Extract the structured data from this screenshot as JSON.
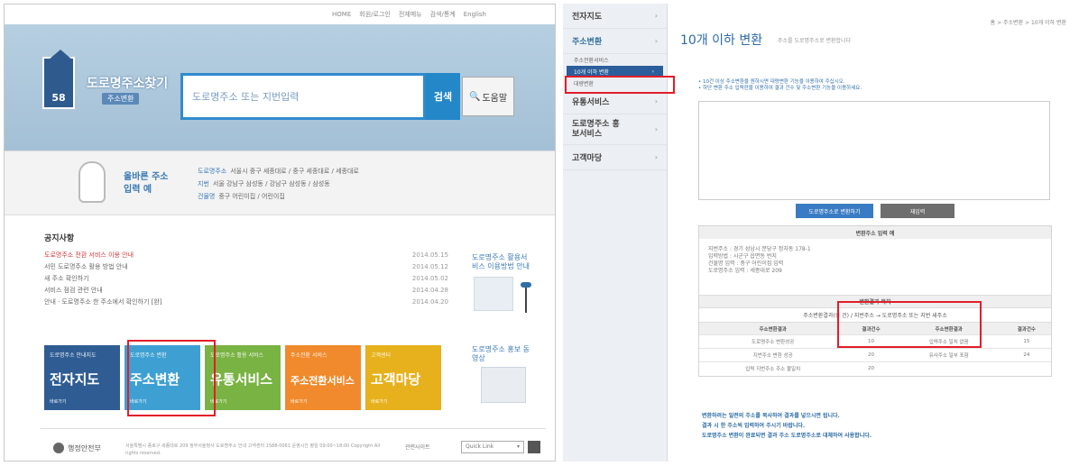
{
  "left": {
    "topbar": [
      "HOME",
      "회원/로그인",
      "전체메뉴",
      "검색/통계",
      "English"
    ],
    "logo": {
      "title": "도로명주소찾기",
      "subtitle": "주소변환",
      "badge": "58"
    },
    "search": {
      "placeholder": "도로명주소 또는 지번입력",
      "button": "검색",
      "help": "도움말"
    },
    "info": {
      "title": "올바른 주소 입력 예",
      "lines": [
        {
          "k": "도로명주소",
          "v": "서울시 중구 세종대로 / 중구 세종대로 / 세종대로"
        },
        {
          "k": "지번",
          "v": "서울 강남구 삼성동 / 강남구 삼성동 / 삼성동"
        },
        {
          "k": "건물명",
          "v": "중구 어린이집 / 어린이집"
        }
      ]
    },
    "notices": {
      "title": "공지사항",
      "items": [
        {
          "text": "도로명주소 전환 서비스 이용 안내",
          "date": "2014.05.15",
          "hot": true
        },
        {
          "text": "서민 도로명주소 활용 방법 안내",
          "date": "2014.05.12",
          "hot": false
        },
        {
          "text": "새 주소 확인하기",
          "date": "2014.05.02",
          "hot": false
        },
        {
          "text": "서비스 점검 관련 안내",
          "date": "2014.04.28",
          "hot": false
        },
        {
          "text": "안내 · 도로명주소 한 주소에서 확인하기 [완]",
          "date": "2014.04.20",
          "hot": false
        }
      ]
    },
    "promo": {
      "text": "도로명주소 활용서비스 이용방법 안내"
    },
    "tiles": [
      {
        "small": "도로명주소 안내지도",
        "big": "전자지도",
        "mini": "바로가기"
      },
      {
        "small": "도로명주소 변환",
        "big": "주소변환",
        "mini": "바로가기"
      },
      {
        "small": "도로명주소 활용 서비스",
        "big": "유통서비스",
        "mini": "바로가기"
      },
      {
        "small": "주소전환 서비스",
        "big": "주소전환서비스",
        "mini": "바로가기"
      },
      {
        "small": "고객센터",
        "big": "고객마당",
        "mini": "바로가기"
      }
    ],
    "promo2": {
      "text": "도로명주소 홍보 동영상"
    },
    "footer": {
      "org": "행정안전부",
      "text": "서울특별시 종로구 세종대로 209 정부서울청사 도로명주소 안내 고객센터 1588-0061 운영시간 평일 09:00~18:00 Copyright All rights reserved.",
      "right": "관련사이트",
      "select": "Quick Link"
    }
  },
  "right": {
    "sidebar": {
      "items": [
        {
          "label": "전자지도",
          "active": false
        },
        {
          "label": "주소변환",
          "active": true
        }
      ],
      "subs": [
        {
          "label": "주소전환서비스",
          "selected": false
        },
        {
          "label": "10개 이하 변환",
          "selected": true
        },
        {
          "label": "대량변환",
          "selected": false
        }
      ],
      "items2": [
        {
          "label": "유통서비스"
        },
        {
          "label": "도로명주소 홍보서비스"
        },
        {
          "label": "고객마당"
        }
      ]
    },
    "crumb": "홈 > 주소변환 > 10개 이하 변환",
    "title": "10개 이하 변환",
    "subtitle": "주소를 도로명주소로 변환합니다",
    "notes": [
      "• 10건 이상 주소변환을 원하시면 대량변환 기능을 이용하여 주십시오.",
      "• 하단 변환 주소 입력란을 이용하여 결과 건수 및 주소변환 기능을 이용하세요."
    ],
    "buttons": {
      "convert": "도로명주소로 변환하기",
      "reset": "재입력"
    },
    "result": {
      "header": "변환주소 입력 예",
      "body": [
        "지번주소 : 경기 성남시 분당구 정자동 178-1",
        "입력방법 : 시군구 읍면동 번지",
        "건물명 입력 : 중구 어린이집 입력",
        "도로명주소 입력 : 세종대로 209"
      ],
      "header2": "변환결과 목차",
      "line": "주소변환결과(총 건) / 지번주소 → 도로명주소 또는 지번 새주소",
      "columns": [
        "주소변환결과",
        "결과건수",
        "주소변환결과",
        "결과건수"
      ],
      "rows": [
        [
          "도로명주소 변환성공",
          "10",
          "입력주소 일치 없음",
          "15"
        ],
        [
          "지번주소 변환 성공",
          "20",
          "유사주소 일부 포함",
          "24"
        ],
        [
          "입력 지번주소 주소 불일치",
          "20",
          "",
          ""
        ]
      ]
    },
    "foot_notes": [
      "변환하려는 일련의 주소를 복사하여 결과를 넣으시면 됩니다.",
      "결과 시 한 주소씩 입력하여 주시기 바랍니다.",
      "도로명주소 변환이 완료되면 결과 주소 도로명주소로 대체하여 사용합니다."
    ]
  },
  "colors": {
    "accent": "#2f6ea6",
    "highlight": "#e21e2a"
  }
}
